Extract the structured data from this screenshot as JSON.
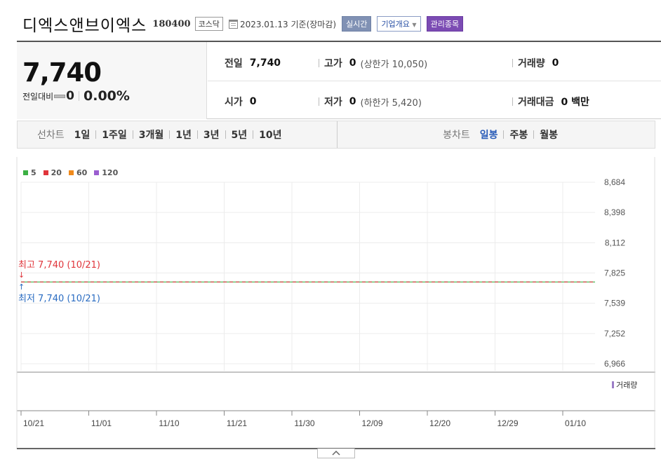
{
  "header": {
    "name": "디엑스앤브이엑스",
    "code": "180400",
    "market": "코스닥",
    "date": "2023.01.13",
    "date_suffix": "기준(장마감)",
    "btn_realtime": "실시간",
    "btn_company": "기업개요",
    "btn_manage": "관리종목"
  },
  "price": {
    "current": "7,740",
    "diff_label": "전일대비",
    "diff_value": "0",
    "diff_pct": "0.00%"
  },
  "stats": {
    "prev_label": "전일",
    "prev_value": "7,740",
    "high_label": "고가",
    "high_value": "0",
    "upper_limit": "(상한가 10,050)",
    "volume_label": "거래량",
    "volume_value": "0",
    "open_label": "시가",
    "open_value": "0",
    "low_label": "저가",
    "low_value": "0",
    "lower_limit": "(하한가 5,420)",
    "amount_label": "거래대금",
    "amount_value": "0 백만"
  },
  "period": {
    "label": "선차트",
    "items": [
      "1일",
      "1주일",
      "3개월",
      "1년",
      "3년",
      "5년",
      "10년"
    ],
    "candle_label": "봉차트",
    "candle_items": [
      "일봉",
      "주봉",
      "월봉"
    ],
    "candle_active": "일봉"
  },
  "chart_data": {
    "type": "line",
    "legend": [
      {
        "name": "5",
        "color": "#3cb043"
      },
      {
        "name": "20",
        "color": "#e0353b"
      },
      {
        "name": "60",
        "color": "#f08a1c"
      },
      {
        "name": "120",
        "color": "#9b5ed0"
      }
    ],
    "x_ticks": [
      "10/21",
      "11/01",
      "11/10",
      "11/21",
      "11/30",
      "12/09",
      "12/20",
      "12/29",
      "01/10"
    ],
    "y_ticks": [
      "8,684",
      "8,398",
      "8,112",
      "7,825",
      "7,539",
      "7,252",
      "6,966"
    ],
    "ylim": [
      6966,
      8684
    ],
    "series_value": 7740,
    "high_annotation": "최고 7,740 (10/21)",
    "low_annotation": "최저 7,740 (10/21)",
    "high_color": "#e0353b",
    "low_color": "#2a6cc2",
    "volume_label": "거래량"
  }
}
